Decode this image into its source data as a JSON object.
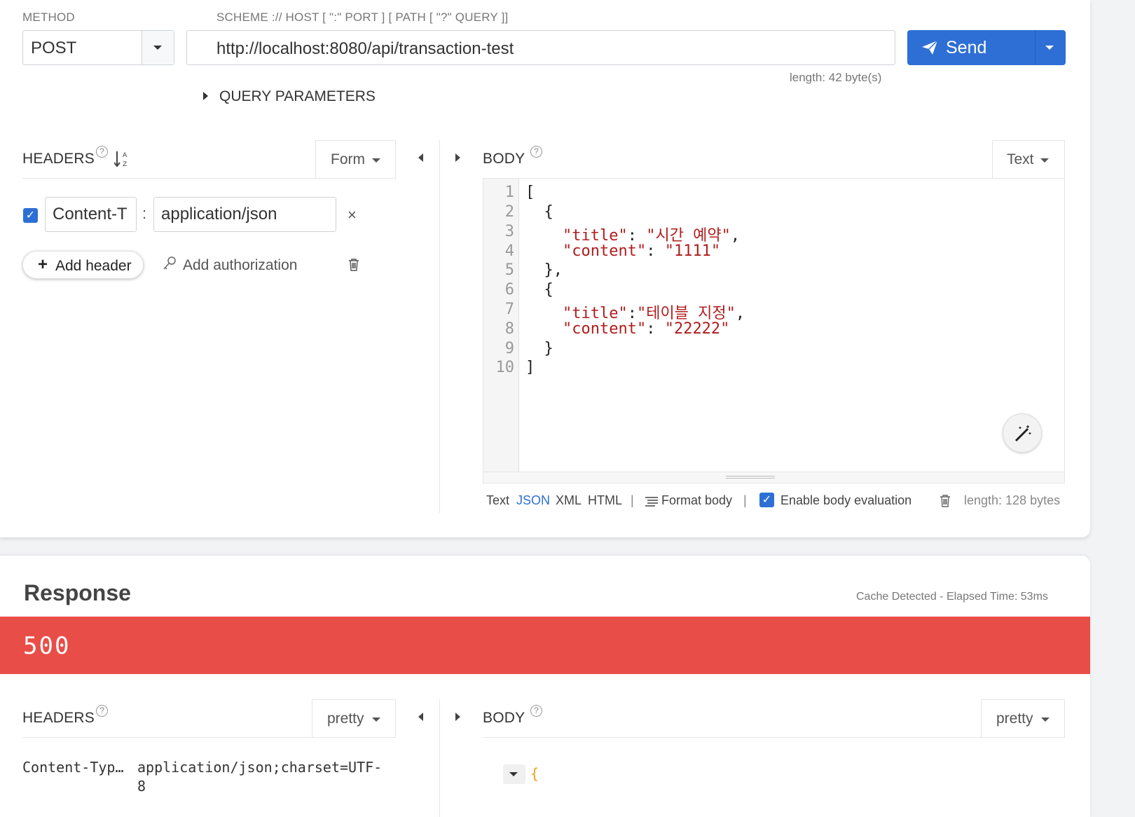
{
  "request": {
    "method_label": "METHOD",
    "method_value": "POST",
    "url_label": "SCHEME :// HOST [ \":\" PORT ] [ PATH [ \"?\" QUERY ]]",
    "url_value": "http://localhost:8080/api/transaction-test",
    "url_length": "length: 42 byte(s)",
    "send_label": "Send",
    "query_params_label": "QUERY PARAMETERS"
  },
  "headers": {
    "title": "HEADERS",
    "mode": "Form",
    "rows": [
      {
        "enabled": true,
        "name": "Content-T",
        "value": "application/json"
      }
    ],
    "add_header_label": "Add header",
    "add_auth_label": "Add authorization"
  },
  "body": {
    "title": "BODY",
    "mode": "Text",
    "line_numbers": [
      "1",
      "2",
      "3",
      "4",
      "5",
      "6",
      "7",
      "8",
      "9",
      "10"
    ],
    "lines": [
      "[",
      "  {",
      "    \"title\": \"시간 예약\",",
      "    \"content\": \"1111\"",
      "  },",
      "  {",
      "    \"title\":\"테이블 지정\",",
      "    \"content\": \"22222\"",
      "  }",
      "]"
    ],
    "formats": [
      "Text",
      "JSON",
      "XML",
      "HTML"
    ],
    "active_format": "JSON",
    "format_body_label": "Format body",
    "enable_eval_label": "Enable body evaluation",
    "enable_eval_checked": true,
    "length": "length: 128 bytes"
  },
  "response": {
    "title": "Response",
    "meta": "Cache Detected - Elapsed Time: 53ms",
    "status_code": "500",
    "status_color": "#e84e47",
    "headers_title": "HEADERS",
    "headers_mode": "pretty",
    "body_title": "BODY",
    "body_mode": "pretty",
    "header_rows": [
      {
        "name": "Content-Typ…",
        "value": "application/json;charset=UTF-",
        "value_wrap": "8"
      }
    ],
    "body_preview": "{"
  },
  "colors": {
    "accent": "#2d6fd4",
    "error": "#e84e47"
  }
}
